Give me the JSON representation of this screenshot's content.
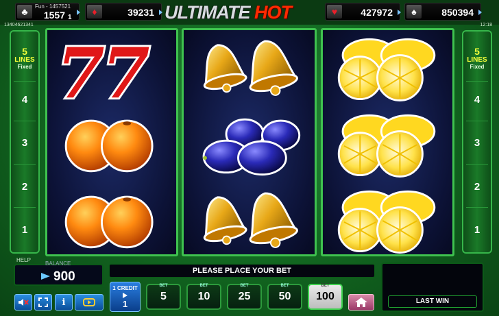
{
  "header": {
    "fun_label": "Fun - 1457521",
    "title_part1": "ULTIMATE",
    "title_part2": "HOT",
    "left_code": "13404621341",
    "right_code": "12:18"
  },
  "jackpots": [
    {
      "suit": "♣",
      "suit_color": "#ffffff",
      "value": "1557",
      "sub": "1"
    },
    {
      "suit": "♦",
      "suit_color": "#e8202a",
      "value": "39231"
    },
    {
      "suit": "♥",
      "suit_color": "#e8202a",
      "value": "427972"
    },
    {
      "suit": "♠",
      "suit_color": "#ffffff",
      "value": "850394"
    }
  ],
  "lines_panel": {
    "count": "5",
    "word": "LINES",
    "fixed": "Fixed",
    "numbers": [
      "4",
      "3",
      "2",
      "1"
    ]
  },
  "reels": [
    [
      "sevens",
      "orange",
      "orange"
    ],
    [
      "bell",
      "plum",
      "bell"
    ],
    [
      "lemon",
      "lemon",
      "lemon"
    ]
  ],
  "bottom": {
    "help": "HELP",
    "balance_label": "BALANCE",
    "balance": "900",
    "message": "PLEASE PLACE YOUR BET",
    "last_win": "LAST WIN",
    "credit_label": "1 CREDIT",
    "credit_value": "1",
    "bet_caption": "BET",
    "bets": [
      "5",
      "10",
      "25",
      "50",
      "100"
    ],
    "active_bet": "100",
    "controls": [
      "sound-icon",
      "fullscreen-icon",
      "info-icon",
      "autoplay-icon"
    ],
    "home_icon": "home-icon"
  },
  "colors": {
    "accent_green": "#3fc24f",
    "reel_bg": "#0c1236",
    "title_red": "#ff2a00",
    "lines_yellow": "#f4ff3a"
  }
}
